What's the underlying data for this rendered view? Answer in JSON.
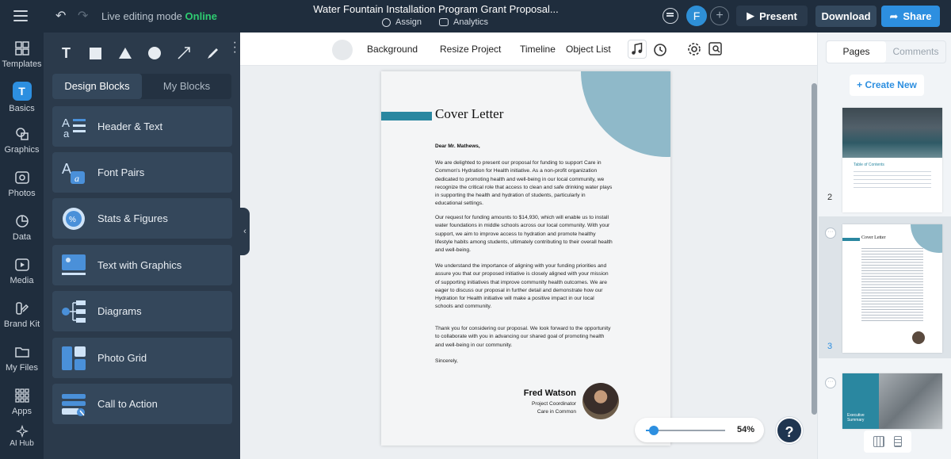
{
  "topbar": {
    "live_label": "Live editing mode",
    "live_status": "Online",
    "doc_title": "Water Fountain Installation Program Grant Proposal...",
    "assign_label": "Assign",
    "analytics_label": "Analytics",
    "avatar_initial": "F",
    "present_label": "Present",
    "download_label": "Download",
    "share_label": "Share"
  },
  "leftnav": {
    "items": [
      {
        "label": "Templates",
        "icon": "templates-icon"
      },
      {
        "label": "Basics",
        "icon": "basics-icon"
      },
      {
        "label": "Graphics",
        "icon": "graphics-icon"
      },
      {
        "label": "Photos",
        "icon": "photos-icon"
      },
      {
        "label": "Data",
        "icon": "data-icon"
      },
      {
        "label": "Media",
        "icon": "media-icon"
      },
      {
        "label": "Brand Kit",
        "icon": "brand-kit-icon"
      },
      {
        "label": "My Files",
        "icon": "my-files-icon"
      },
      {
        "label": "Apps",
        "icon": "apps-icon"
      },
      {
        "label": "AI Hub",
        "icon": "ai-hub-icon"
      }
    ],
    "basics_glyph": "T"
  },
  "panel": {
    "text_tool": "T",
    "tabs": [
      "Design Blocks",
      "My Blocks"
    ],
    "blocks": [
      "Header & Text",
      "Font Pairs",
      "Stats & Figures",
      "Text with Graphics",
      "Diagrams",
      "Photo Grid",
      "Call to Action"
    ],
    "collapse_glyph": "‹"
  },
  "canvas_toolbar": {
    "background_label": "Background",
    "resize_label": "Resize Project",
    "timeline_label": "Timeline",
    "object_list_label": "Object List"
  },
  "page": {
    "title": "Cover Letter",
    "salutation": "Dear Mr. Mathews,",
    "paragraphs": [
      "We are delighted to present our proposal for funding to support Care in Common's Hydration for Health initiative. As a non-profit organization dedicated to promoting health and well-being in our local community, we recognize the critical role that access to clean and safe drinking water plays in supporting the health and hydration of students, particularly in educational settings.",
      "Our request for funding amounts to $14,930, which will enable us to install water foundations in middle schools across our local community. With your support, we aim to improve access to hydration and promote healthy lifestyle habits among students, ultimately contributing to their overall health and well-being.",
      "We understand the importance of aligning with your funding priorities and assure you that our proposed initiative is closely aligned with your mission of supporting initiatives that improve community health outcomes. We are eager to discuss our proposal in further detail and demonstrate how our Hydration for Health initiative will make a positive impact in our local schools and community.",
      "Thank you for considering our proposal. We look forward to the opportunity to collaborate with you in advancing our shared goal of promoting health and well-being in our community.",
      "Sincerely,"
    ],
    "signer_name": "Fred Watson",
    "signer_role": "Project Coordinator",
    "signer_org": "Care in Common"
  },
  "zoom": {
    "value": "54%",
    "fraction": 0.1
  },
  "help_label": "?",
  "rpanel": {
    "tabs": [
      "Pages",
      "Comments"
    ],
    "create_new": "+ Create New",
    "thumbnails": [
      {
        "number": "2",
        "heading": "Table of Contents"
      },
      {
        "number": "3",
        "heading": "Cover Letter"
      },
      {
        "number": "",
        "heading": "Executive Summary"
      }
    ]
  },
  "colors": {
    "accent": "#2d8fe0",
    "online": "#2ecc71",
    "dark_bg": "#1f2d3d",
    "panel_bg": "#2b3a4b",
    "page_circle": "#8fb9c9",
    "page_bar": "#2a87a0"
  }
}
